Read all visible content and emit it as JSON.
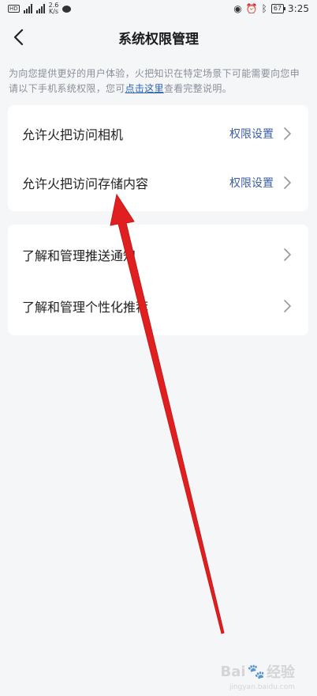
{
  "status_bar": {
    "network_speed": "2.6",
    "network_unit": "K/s",
    "battery": "67",
    "time": "3:25"
  },
  "header": {
    "title": "系统权限管理"
  },
  "intro": {
    "text_before": "为向您提供更好的用户体验，火把知识在特定场景下可能需要向您申请以下手机系统权限，您可",
    "link_text": "点击这里",
    "text_after": "查看完整说明。"
  },
  "permission_group": [
    {
      "label": "允许火把访问相机",
      "action": "权限设置"
    },
    {
      "label": "允许火把访问存储内容",
      "action": "权限设置"
    }
  ],
  "manage_group": [
    {
      "label": "了解和管理推送通知"
    },
    {
      "label": "了解和管理个性化推荐"
    }
  ],
  "annotation": {
    "arrow_color": "#e02020"
  },
  "watermark": {
    "text": "Bai",
    "brand": "经验",
    "sub": "jingyan.baidu.com"
  }
}
